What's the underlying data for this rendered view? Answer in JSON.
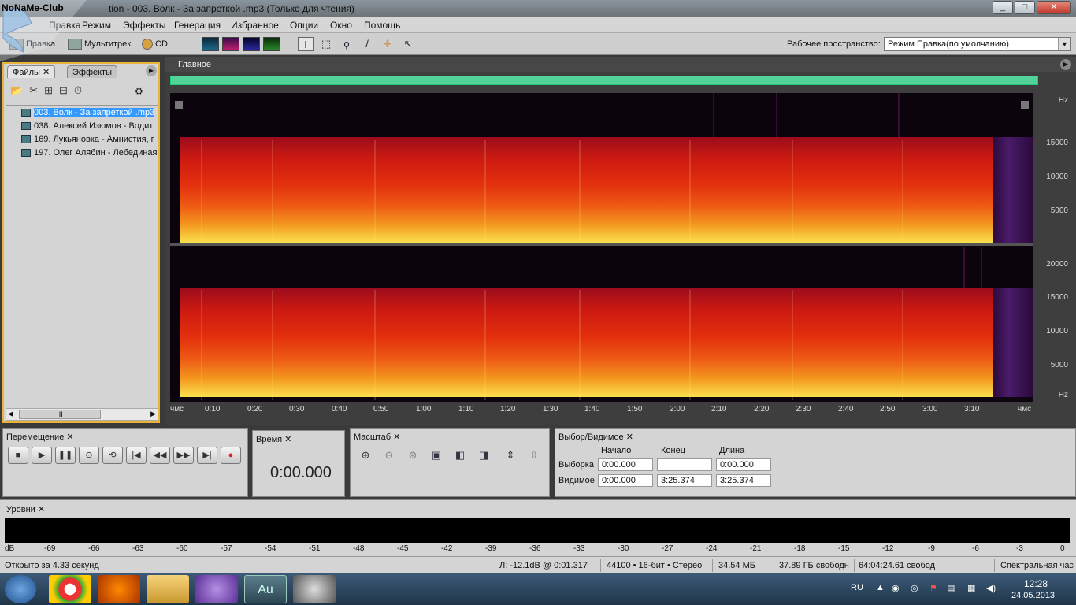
{
  "window": {
    "title": "Wolf_Audition - 003. Волк - За запреткой .mp3 (Только для чтения)",
    "title_visible": "tion - 003. Волк - За запреткой .mp3 (Только для чтения)",
    "minimize": "_",
    "maximize": "□",
    "close": "✕"
  },
  "logo": {
    "text": "NoNaMe-Club"
  },
  "menu": [
    "Правка",
    "Режим",
    "Эффекты",
    "Генерация",
    "Избранное",
    "Опции",
    "Окно",
    "Помощь"
  ],
  "toolbar": {
    "edit_label": "Правка",
    "multitrack_label": "Мультитрек",
    "cd_label": "CD",
    "workspace_label": "Рабочее пространство:",
    "workspace_value": "Режим Правка(по умолчанию)"
  },
  "files_panel": {
    "tab_files": "Файлы",
    "tab_effects": "Эффекты",
    "items": [
      "003.  Волк - За запреткой .mp3",
      "038.  Алексей Изюмов - Водит",
      "169.  Лукьяновка - Амнистия, г",
      "197.  Олег Алябин - Лебединая"
    ],
    "scroll_grip": "III"
  },
  "main_panel": {
    "title": "Главное",
    "hz_labels_top": [
      "Hz",
      "15000",
      "10000",
      "5000"
    ],
    "hz_labels_bottom": [
      "20000",
      "15000",
      "10000",
      "5000",
      "Hz"
    ],
    "time_labels": [
      "чмс",
      "0:10",
      "0:20",
      "0:30",
      "0:40",
      "0:50",
      "1:00",
      "1:10",
      "1:20",
      "1:30",
      "1:40",
      "1:50",
      "2:00",
      "2:10",
      "2:20",
      "2:30",
      "2:40",
      "2:50",
      "3:00",
      "3:10",
      "чмс"
    ]
  },
  "transport": {
    "title": "Перемещение"
  },
  "time_panel": {
    "title": "Время",
    "value": "0:00.000"
  },
  "zoom_panel": {
    "title": "Масштаб"
  },
  "selection_panel": {
    "title": "Выбор/Видимое",
    "col_start": "Начало",
    "col_end": "Конец",
    "col_length": "Длина",
    "row_selection": "Выборка",
    "row_visible": "Видимое",
    "sel_start": "0:00.000",
    "sel_end": "",
    "sel_length": "0:00.000",
    "vis_start": "0:00.000",
    "vis_end": "3:25.374",
    "vis_length": "3:25.374"
  },
  "levels_panel": {
    "title": "Уровни",
    "db_labels": [
      "dB",
      "-69",
      "-66",
      "-63",
      "-60",
      "-57",
      "-54",
      "-51",
      "-48",
      "-45",
      "-42",
      "-39",
      "-36",
      "-33",
      "-30",
      "-27",
      "-24",
      "-21",
      "-18",
      "-15",
      "-12",
      "-9",
      "-6",
      "-3",
      "0"
    ]
  },
  "status": {
    "opened": "Открыто за 4.33 секунд",
    "cursor": "Л: -12.1dB @   0:01.317",
    "format": "44100 • 16-бит • Стерео",
    "size": "34.54 МБ",
    "free_disk": "37.89 ГБ свободн",
    "free_time": "64:04:24.61 свобод",
    "view": "Спектральная час"
  },
  "taskbar": {
    "audition_label": "Au",
    "lang": "RU",
    "time": "12:28",
    "date": "24.05.2013"
  },
  "colors": {
    "accent_overview": "#52d39a",
    "panel_focus": "#e8b53a",
    "selection": "#3399ff"
  }
}
